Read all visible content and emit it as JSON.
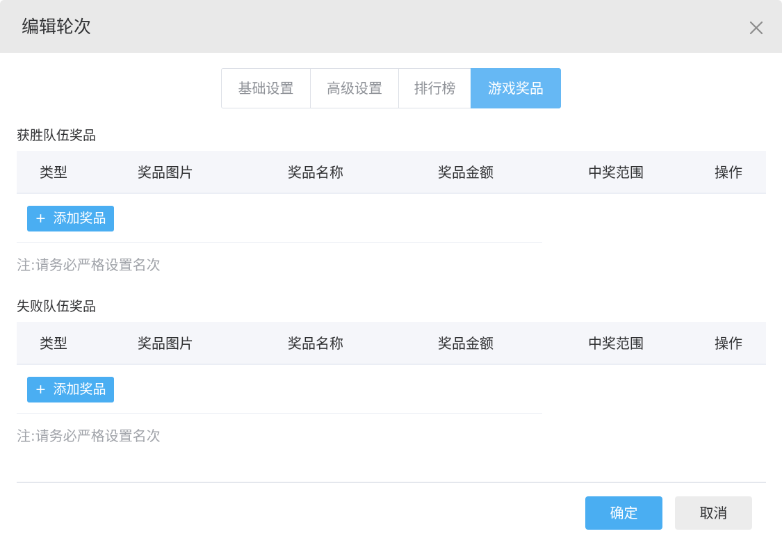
{
  "dialog": {
    "title": "编辑轮次",
    "close_icon": "close-icon"
  },
  "tabs": [
    {
      "label": "基础设置",
      "active": false
    },
    {
      "label": "高级设置",
      "active": false
    },
    {
      "label": "排行榜",
      "active": false
    },
    {
      "label": "游戏奖品",
      "active": true
    }
  ],
  "win_section": {
    "title": "获胜队伍奖品",
    "columns": [
      "类型",
      "奖品图片",
      "奖品名称",
      "奖品金额",
      "中奖范围",
      "操作"
    ],
    "add_button": "添加奖品",
    "note": "注:请务必严格设置名次"
  },
  "lose_section": {
    "title": "失败队伍奖品",
    "columns": [
      "类型",
      "奖品图片",
      "奖品名称",
      "奖品金额",
      "中奖范围",
      "操作"
    ],
    "add_button": "添加奖品",
    "note": "注:请务必严格设置名次"
  },
  "footer": {
    "confirm": "确定",
    "cancel": "取消"
  },
  "colors": {
    "accent": "#4aaef2",
    "active_tab": "#66b8f4",
    "header_bg": "#e9e9e9"
  }
}
